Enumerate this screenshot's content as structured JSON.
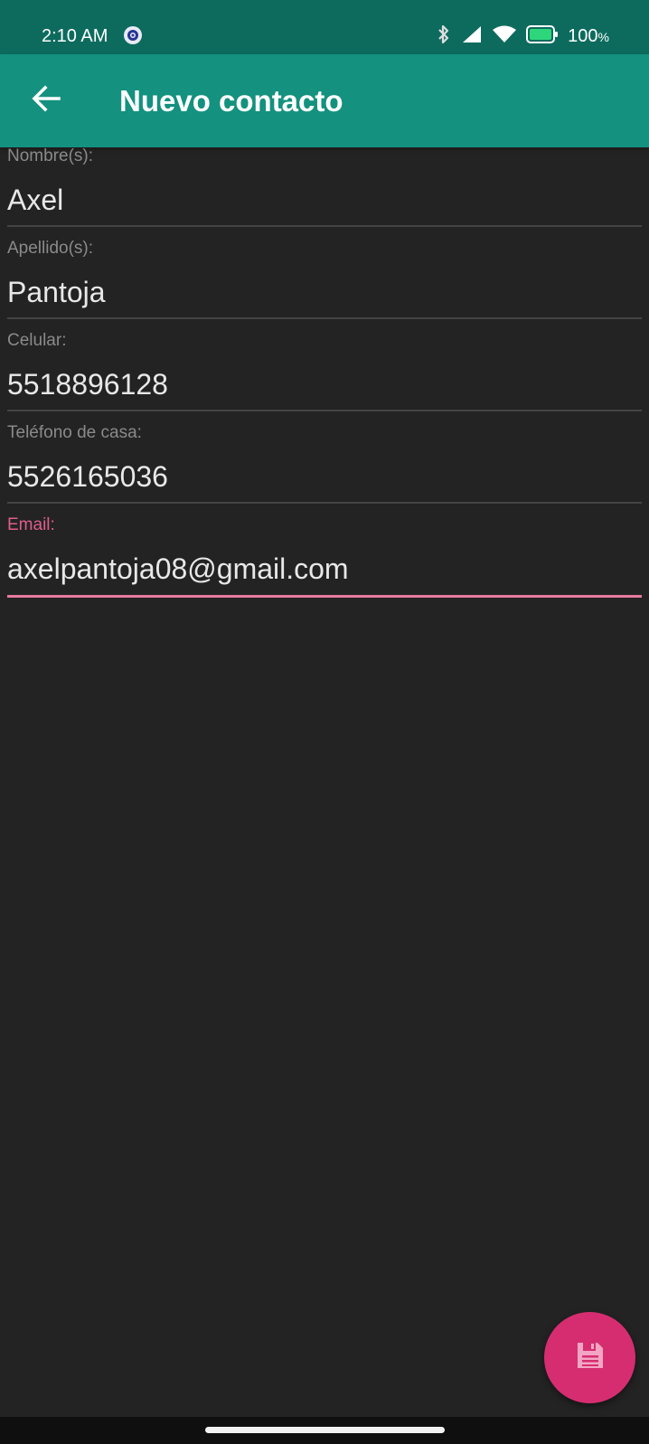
{
  "status_bar": {
    "time": "2:10 AM",
    "battery_level": "100",
    "battery_unit": "%",
    "icons": [
      "app-notification-icon",
      "bluetooth-icon",
      "signal-icon",
      "wifi-icon",
      "battery-icon"
    ]
  },
  "app_bar": {
    "title": "Nuevo contacto",
    "back_icon": "arrow-back-icon",
    "color": "#14917f"
  },
  "form": {
    "fields": [
      {
        "label": "Nombre(s):",
        "value": "Axel"
      },
      {
        "label": "Apellido(s):",
        "value": "Pantoja"
      },
      {
        "label": "Celular:",
        "value": "5518896128"
      },
      {
        "label": "Teléfono de casa:",
        "value": "5526165036"
      },
      {
        "label": "Email:",
        "value": "axelpantoja08@gmail.com",
        "focused": true
      }
    ]
  },
  "fab": {
    "icon": "save-icon",
    "color": "#d62d71"
  },
  "colors": {
    "accent": "#e05d8c",
    "background": "#232323",
    "status_bar": "#0d6b5e",
    "battery": "#2ed67b"
  }
}
